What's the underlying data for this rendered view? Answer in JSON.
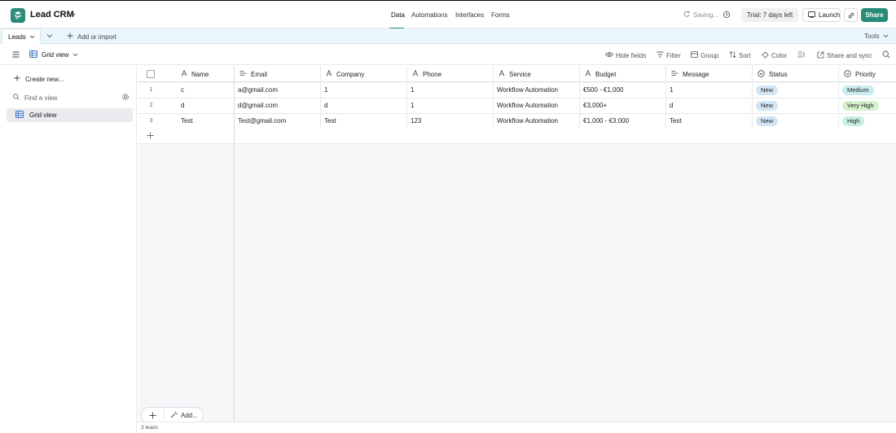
{
  "app": {
    "title": "Lead CRM"
  },
  "nav": {
    "data": "Data",
    "automations": "Automations",
    "interfaces": "Interfaces",
    "forms": "Forms"
  },
  "header": {
    "saving": "Saving...",
    "trial": "Trial: 7 days left",
    "launch": "Launch",
    "share": "Share"
  },
  "tabbar": {
    "table_tab": "Leads",
    "add_import": "Add or import",
    "tools": "Tools"
  },
  "viewbar": {
    "view_name": "Grid view",
    "hide_fields": "Hide fields",
    "filter": "Filter",
    "group": "Group",
    "sort": "Sort",
    "color": "Color",
    "share_sync": "Share and sync"
  },
  "sidebar": {
    "create_new": "Create new...",
    "find_view": "Find a view",
    "views": [
      {
        "label": "Grid view"
      }
    ]
  },
  "table": {
    "columns": [
      "Name",
      "Email",
      "Company",
      "Phone",
      "Service",
      "Budget",
      "Message",
      "Status",
      "Priority"
    ],
    "rows": [
      {
        "num": "1",
        "name": "c",
        "email": "a@gmail.com",
        "company": "1",
        "phone": "1",
        "service": "Workflow Automation",
        "budget": "€500 - €1,000",
        "message": "1",
        "status": "New",
        "priority": "Medium"
      },
      {
        "num": "2",
        "name": "d",
        "email": "d@gmail.com",
        "company": "d",
        "phone": "1",
        "service": "Workflow Automation",
        "budget": "€3,000+",
        "message": "d",
        "status": "New",
        "priority": "Very High"
      },
      {
        "num": "3",
        "name": "Test",
        "email": "Test@gmail.com",
        "company": "Test",
        "phone": "123",
        "service": "Workflow Automation",
        "budget": "€1,000 - €3,000",
        "message": "Test",
        "status": "New",
        "priority": "High"
      }
    ],
    "footer_count": "3 leads",
    "add_label": "Add..."
  },
  "colors": {
    "brand": "#2a8c78",
    "status_new": "#d3e5f5",
    "priority_medium": "#c9ecf0",
    "priority_very_high": "#d4f0cc",
    "priority_high": "#c9f0e0"
  }
}
